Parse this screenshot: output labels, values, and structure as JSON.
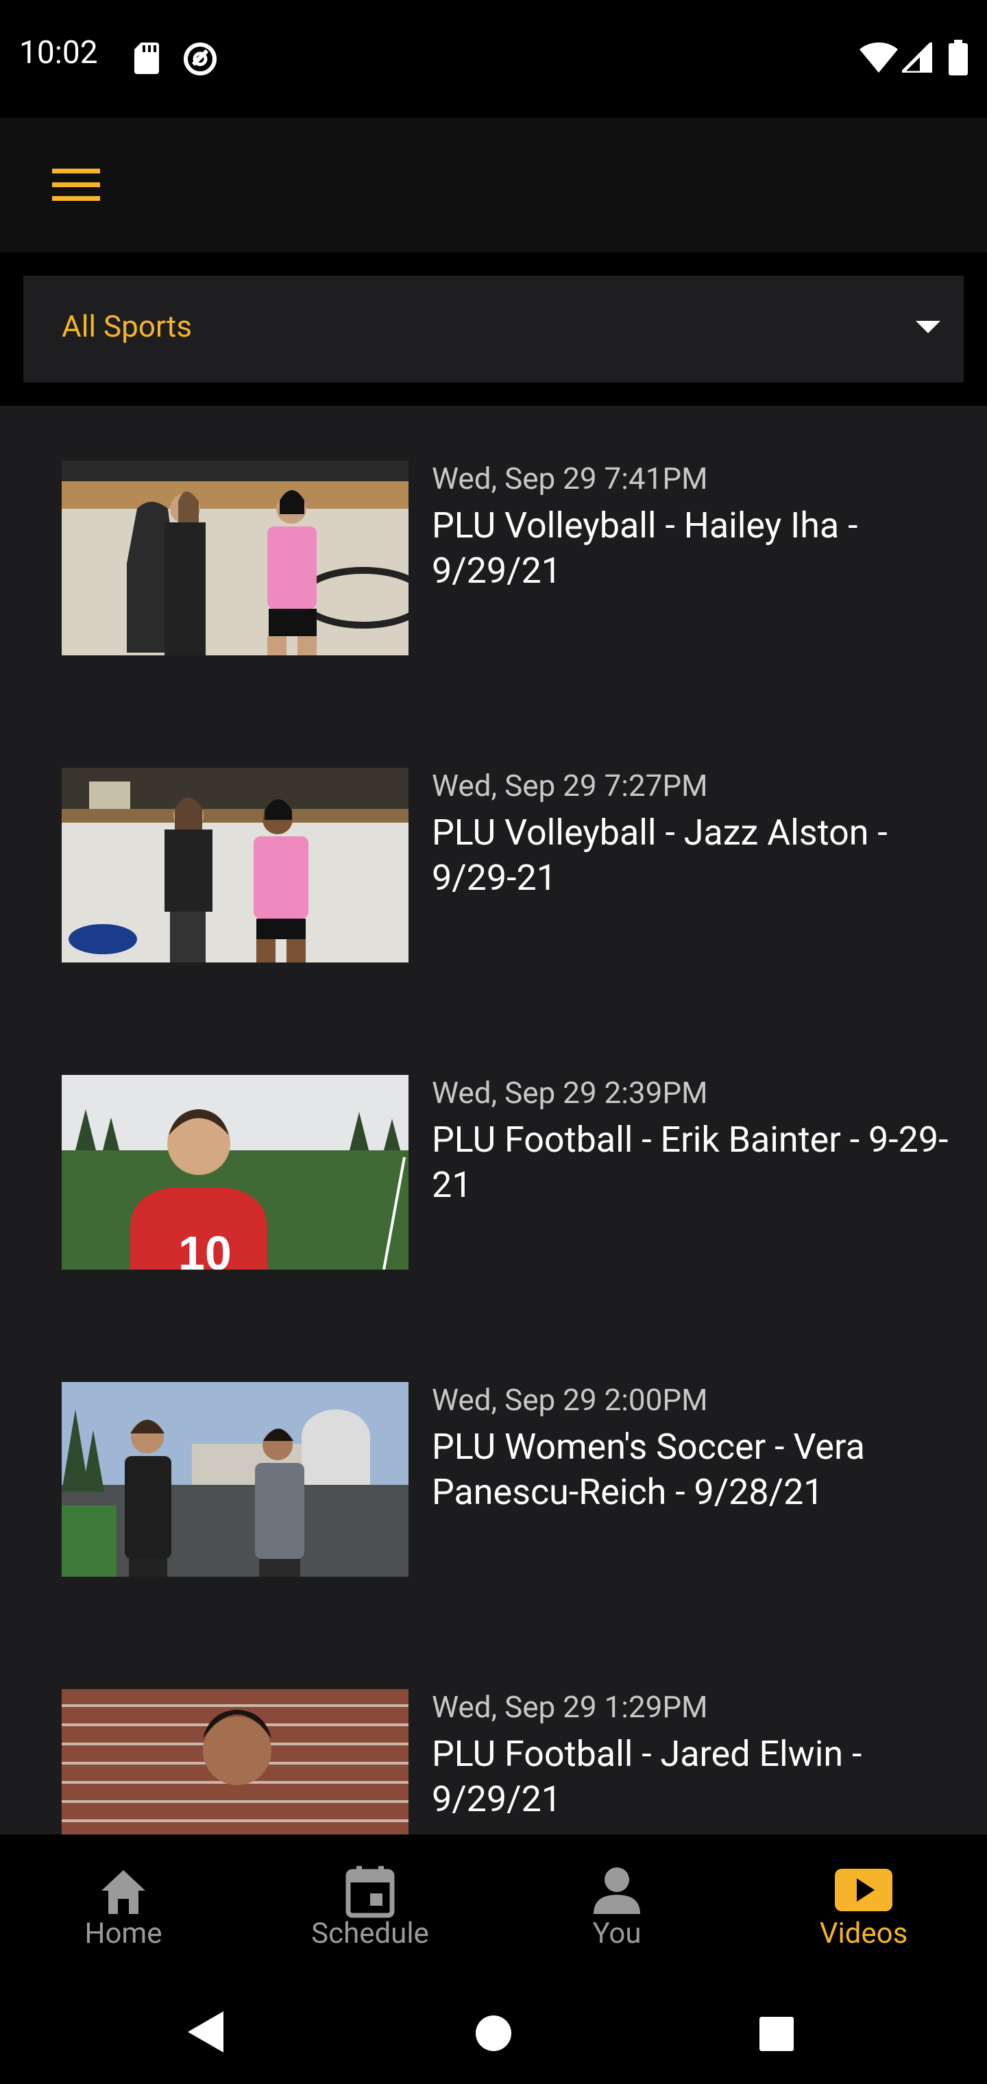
{
  "status_bar": {
    "time": "10:02",
    "left_icons": [
      "sd-card-icon",
      "data-saver-icon"
    ],
    "right_icons": [
      "wifi-icon",
      "cell-signal-icon",
      "battery-icon"
    ]
  },
  "app_bar": {
    "menu_icon": "hamburger-menu-icon"
  },
  "filter": {
    "selected": "All Sports",
    "arrow_icon": "dropdown-arrow-icon"
  },
  "videos": [
    {
      "date": "Wed, Sep 29 7:41PM",
      "title": "PLU Volleyball - Hailey Iha - 9/29/21"
    },
    {
      "date": "Wed, Sep 29 7:27PM",
      "title": "PLU Volleyball - Jazz Alston - 9/29-21"
    },
    {
      "date": "Wed, Sep 29 2:39PM",
      "title": "PLU Football - Erik Bainter - 9-29-21"
    },
    {
      "date": "Wed, Sep 29 2:00PM",
      "title": "PLU Women's Soccer - Vera Panescu-Reich - 9/28/21"
    },
    {
      "date": "Wed, Sep 29 1:29PM",
      "title": "PLU Football - Jared Elwin - 9/29/21"
    }
  ],
  "bottom_nav": [
    {
      "label": "Home",
      "icon": "home-icon",
      "active": false
    },
    {
      "label": "Schedule",
      "icon": "calendar-icon",
      "active": false
    },
    {
      "label": "You",
      "icon": "person-icon",
      "active": false
    },
    {
      "label": "Videos",
      "icon": "video-play-icon",
      "active": true
    }
  ],
  "colors": {
    "accent": "#f5b42a",
    "background": "#1c1c1e",
    "inactive": "#9a9a9a"
  }
}
